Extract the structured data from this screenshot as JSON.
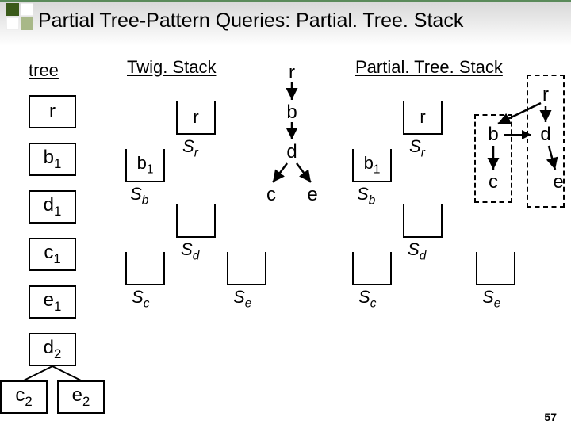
{
  "title": "Partial Tree-Pattern Queries: Partial. Tree. Stack",
  "columns": {
    "tree": "tree",
    "twig": "Twig. Stack",
    "pts": "Partial. Tree. Stack"
  },
  "tree_nodes": {
    "r": "r",
    "b1": "b1",
    "d1": "d1",
    "c1": "c1",
    "e1": "e1",
    "d2": "d2",
    "c2": "c2",
    "e2": "e2"
  },
  "stacks": {
    "sr_item": "r",
    "sr_label": "Sr",
    "sb_item": "b1",
    "sb_label": "Sb",
    "sd_label": "Sd",
    "sc_label": "Sc",
    "se_label": "Se"
  },
  "pattern": {
    "r": "r",
    "b": "b",
    "d": "d",
    "c": "c",
    "e": "e"
  },
  "page": "57"
}
